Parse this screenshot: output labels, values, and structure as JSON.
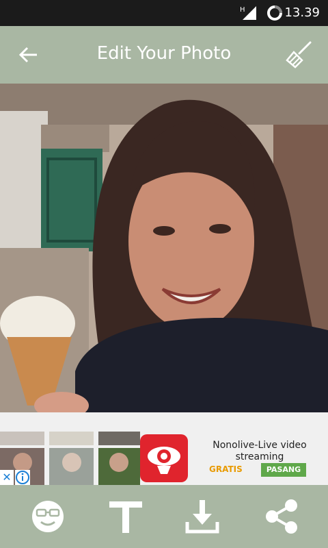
{
  "status_bar": {
    "time": "13.39",
    "network": "H"
  },
  "app_bar": {
    "title": "Edit Your Photo",
    "back_icon": "arrow-back-icon",
    "clean_icon": "broom-icon"
  },
  "ad": {
    "app_name": "Nonolive-Live video streaming",
    "price_label": "GRATIS",
    "install_label": "PASANG",
    "close_symbol": "✕",
    "colors": {
      "gratis": "#e89a00",
      "install": "#5fa84a",
      "icon_bg": "#e0242d"
    }
  },
  "toolbar": {
    "items": [
      {
        "icon": "sticker-face-icon"
      },
      {
        "icon": "text-icon"
      },
      {
        "icon": "download-icon"
      },
      {
        "icon": "share-icon"
      }
    ]
  },
  "theme": {
    "bar": "#a9b7a3",
    "status": "#1b1b1b"
  }
}
